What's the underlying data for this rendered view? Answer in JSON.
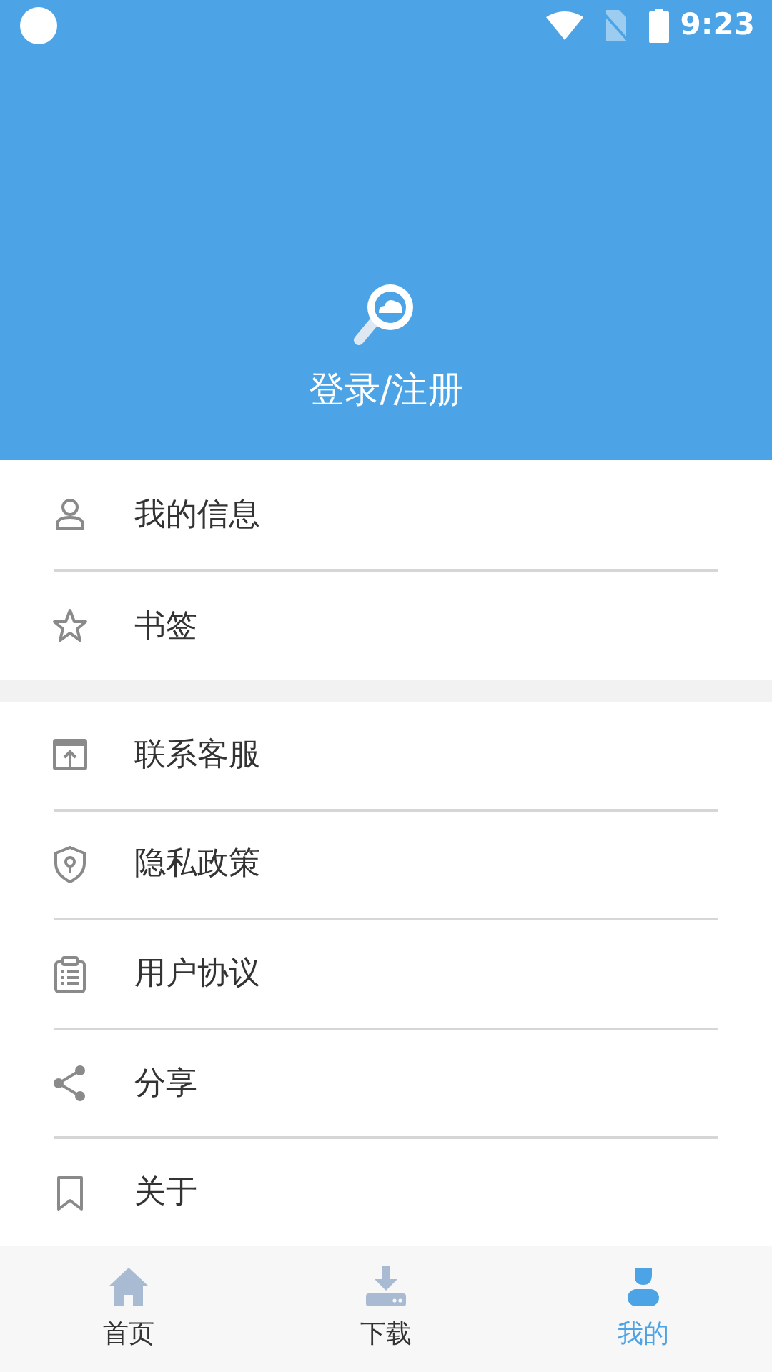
{
  "status_bar": {
    "time": "9:23"
  },
  "header": {
    "login_label": "登录/注册"
  },
  "menu_groups": [
    {
      "items": [
        {
          "label": "我的信息"
        },
        {
          "label": "书签"
        }
      ]
    },
    {
      "items": [
        {
          "label": "联系客服"
        },
        {
          "label": "隐私政策"
        },
        {
          "label": "用户协议"
        },
        {
          "label": "分享"
        },
        {
          "label": "关于"
        }
      ]
    }
  ],
  "bottom_nav": [
    {
      "label": "首页",
      "selected": false
    },
    {
      "label": "下载",
      "selected": false
    },
    {
      "label": "我的",
      "selected": true
    }
  ]
}
